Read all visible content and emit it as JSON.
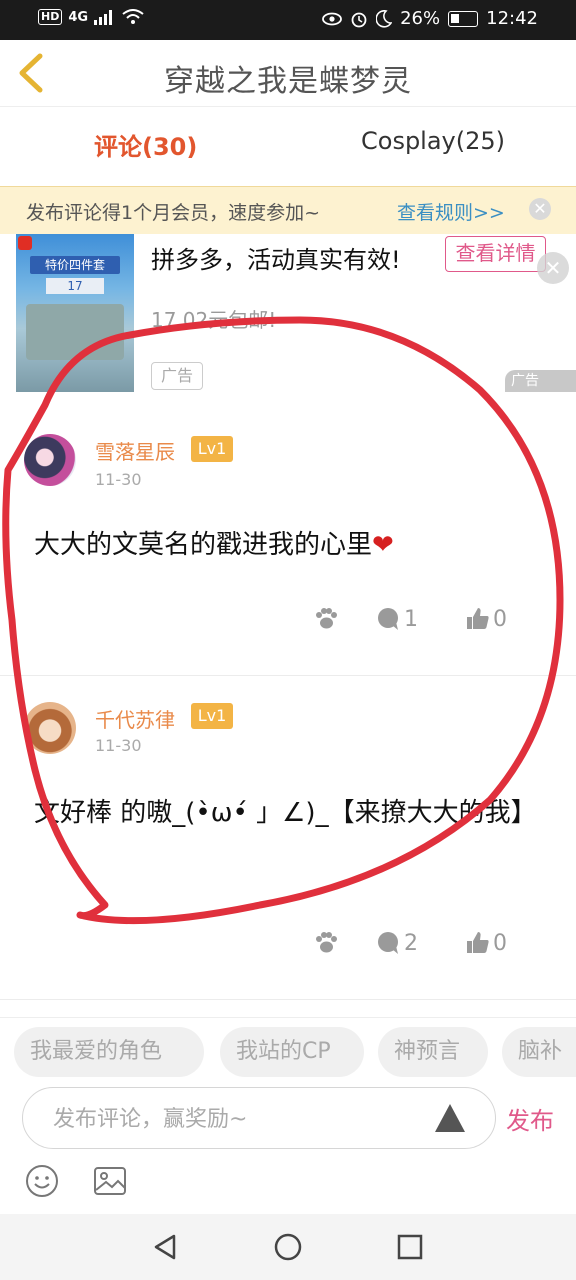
{
  "status_bar": {
    "network": "HD",
    "signal_label": "4G",
    "battery": "26%",
    "time": "12:42",
    "icons": [
      "eye-icon",
      "alarm-icon",
      "moon-icon",
      "battery-icon",
      "wifi-icon",
      "signal-icon"
    ]
  },
  "header": {
    "title": "穿越之我是蝶梦灵",
    "back_icon": "chevron-left-icon"
  },
  "tabs": [
    {
      "label": "评论(30)",
      "active": true
    },
    {
      "label": "Cosplay(25)",
      "active": false
    }
  ],
  "notice": {
    "text": "发布评论得1个月会员，速度参加~",
    "link": "查看规则>>",
    "close_icon": "close-icon"
  },
  "ad": {
    "image_banner": "特价四件套",
    "image_price": "17",
    "title": "拼多多，活动真实有效!",
    "detail_button": "查看详情",
    "subtitle": "17.02元包邮!",
    "tag": "广告",
    "corner_label": "广告"
  },
  "comments": [
    {
      "username": "雪落星辰",
      "level": "Lv1",
      "date": "11-30",
      "text": "大大的文莫名的戳进我的心里",
      "emoji": "❤",
      "comment_count": "1",
      "like_count": "0"
    },
    {
      "username": "千代苏律",
      "level": "Lv1",
      "date": "11-30",
      "text": "文好棒 的嗷_(•̀ω•́ 」∠)_【来撩大大的我】",
      "comment_count": "2",
      "like_count": "0"
    }
  ],
  "topics": [
    "我最爱的角色",
    "我站的CP",
    "神预言",
    "脑补"
  ],
  "composer": {
    "placeholder": "发布评论，赢奖励~",
    "publish_label": "发布"
  },
  "colors": {
    "accent_orange": "#e2562e",
    "username_orange": "#e98a4a",
    "level_badge": "#f3b445",
    "publish_pink": "#e0598a",
    "link_blue": "#3b8fc3",
    "notice_bg": "#fdf2d0",
    "annotation_red": "#e0303c"
  }
}
